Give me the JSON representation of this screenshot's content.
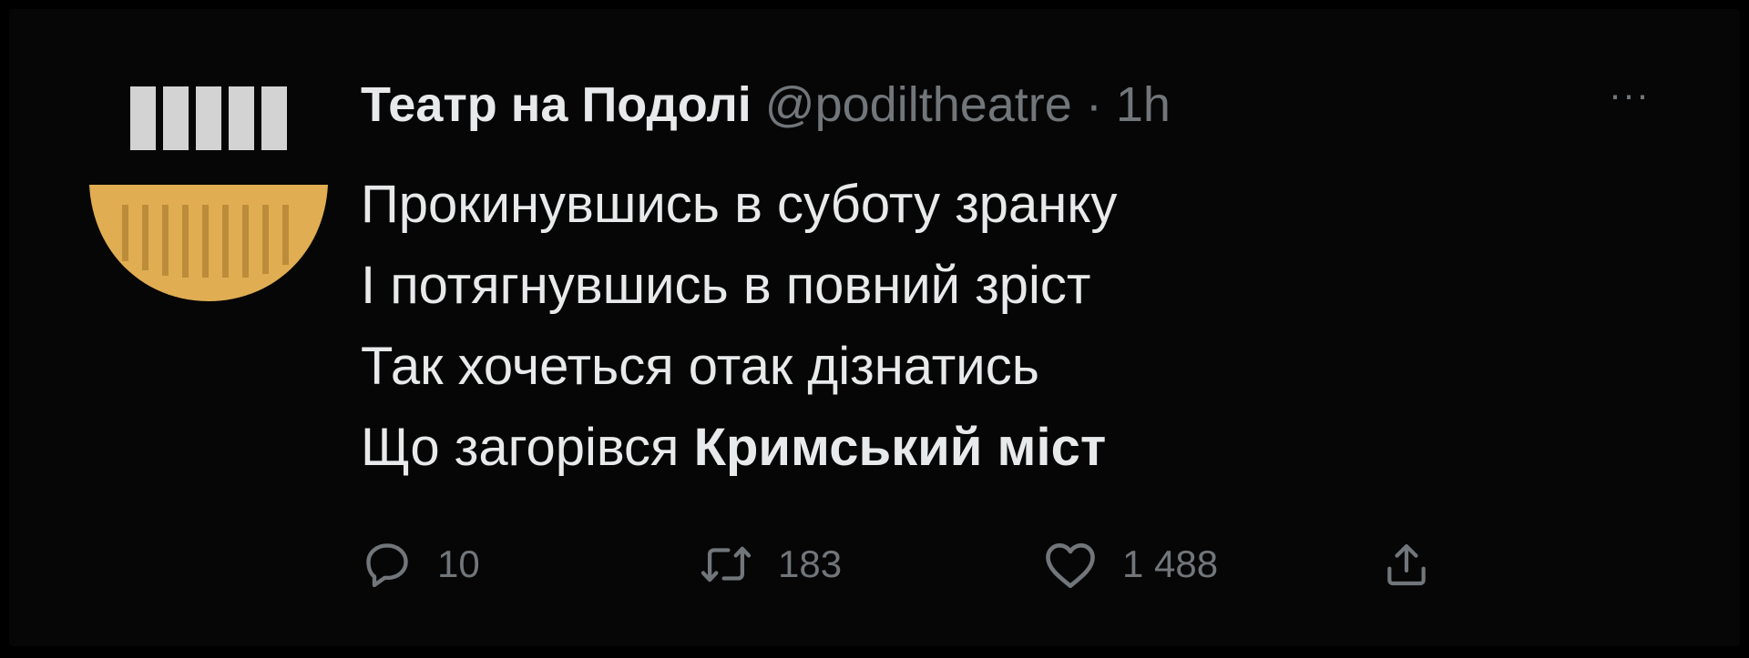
{
  "tweet": {
    "author_name": "Театр на Подолі",
    "handle": "@podiltheatre",
    "separator": "·",
    "time": "1h",
    "more_label": "···",
    "lines": [
      "Прокинувшись в суботу зранку",
      "І потягнувшись в повний зріст",
      "Так хочеться отак дізнатись"
    ],
    "last_line_plain": "Що загорівся ",
    "last_line_bold": "Кримський міст"
  },
  "actions": {
    "replies": "10",
    "retweets": "183",
    "likes": "1 488"
  },
  "icons": {
    "reply": "reply-bubble-icon",
    "retweet": "retweet-arrows-icon",
    "like": "heart-icon",
    "share": "share-upload-icon"
  },
  "colors": {
    "background": "#000000",
    "text": "#e7e9ea",
    "muted": "#71767b",
    "avatar_gold": "#e0ad52",
    "avatar_bars": "#d3d3d3"
  }
}
